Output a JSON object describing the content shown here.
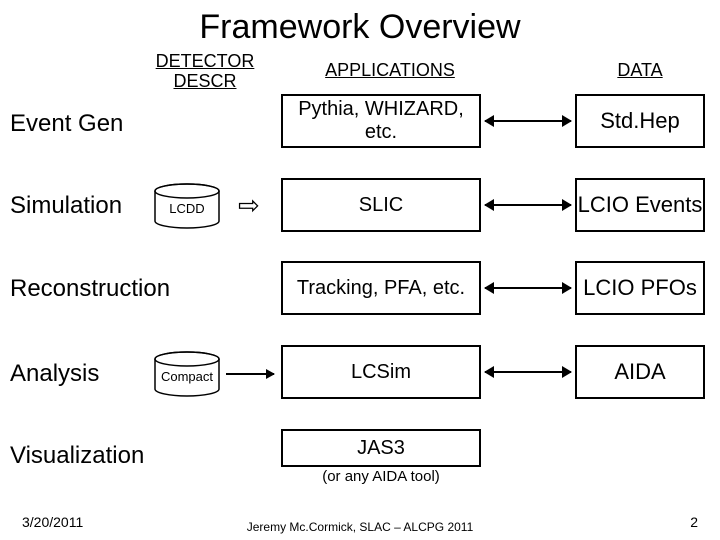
{
  "title": "Framework Overview",
  "headers": {
    "detector": "DETECTOR DESCR",
    "applications": "APPLICATIONS",
    "data": "DATA"
  },
  "rows": {
    "event_gen": "Event Gen",
    "simulation": "Simulation",
    "reconstruction": "Reconstruction",
    "analysis": "Analysis",
    "visualization": "Visualization"
  },
  "detector": {
    "lcdd": "LCDD",
    "compact": "Compact"
  },
  "apps": {
    "event_gen": "Pythia, WHIZARD,  etc.",
    "simulation": "SLIC",
    "reconstruction": "Tracking, PFA, etc.",
    "analysis": "LCSim",
    "visualization": "JAS3",
    "visualization_sub": "(or any AIDA tool)"
  },
  "data": {
    "event_gen": "Std.Hep",
    "simulation": "LCIO Events",
    "reconstruction": "LCIO PFOs",
    "analysis": "AIDA"
  },
  "footer": {
    "date": "3/20/2011",
    "credit": "Jeremy Mc.Cormick, SLAC – ALCPG 2011",
    "page": "2"
  }
}
